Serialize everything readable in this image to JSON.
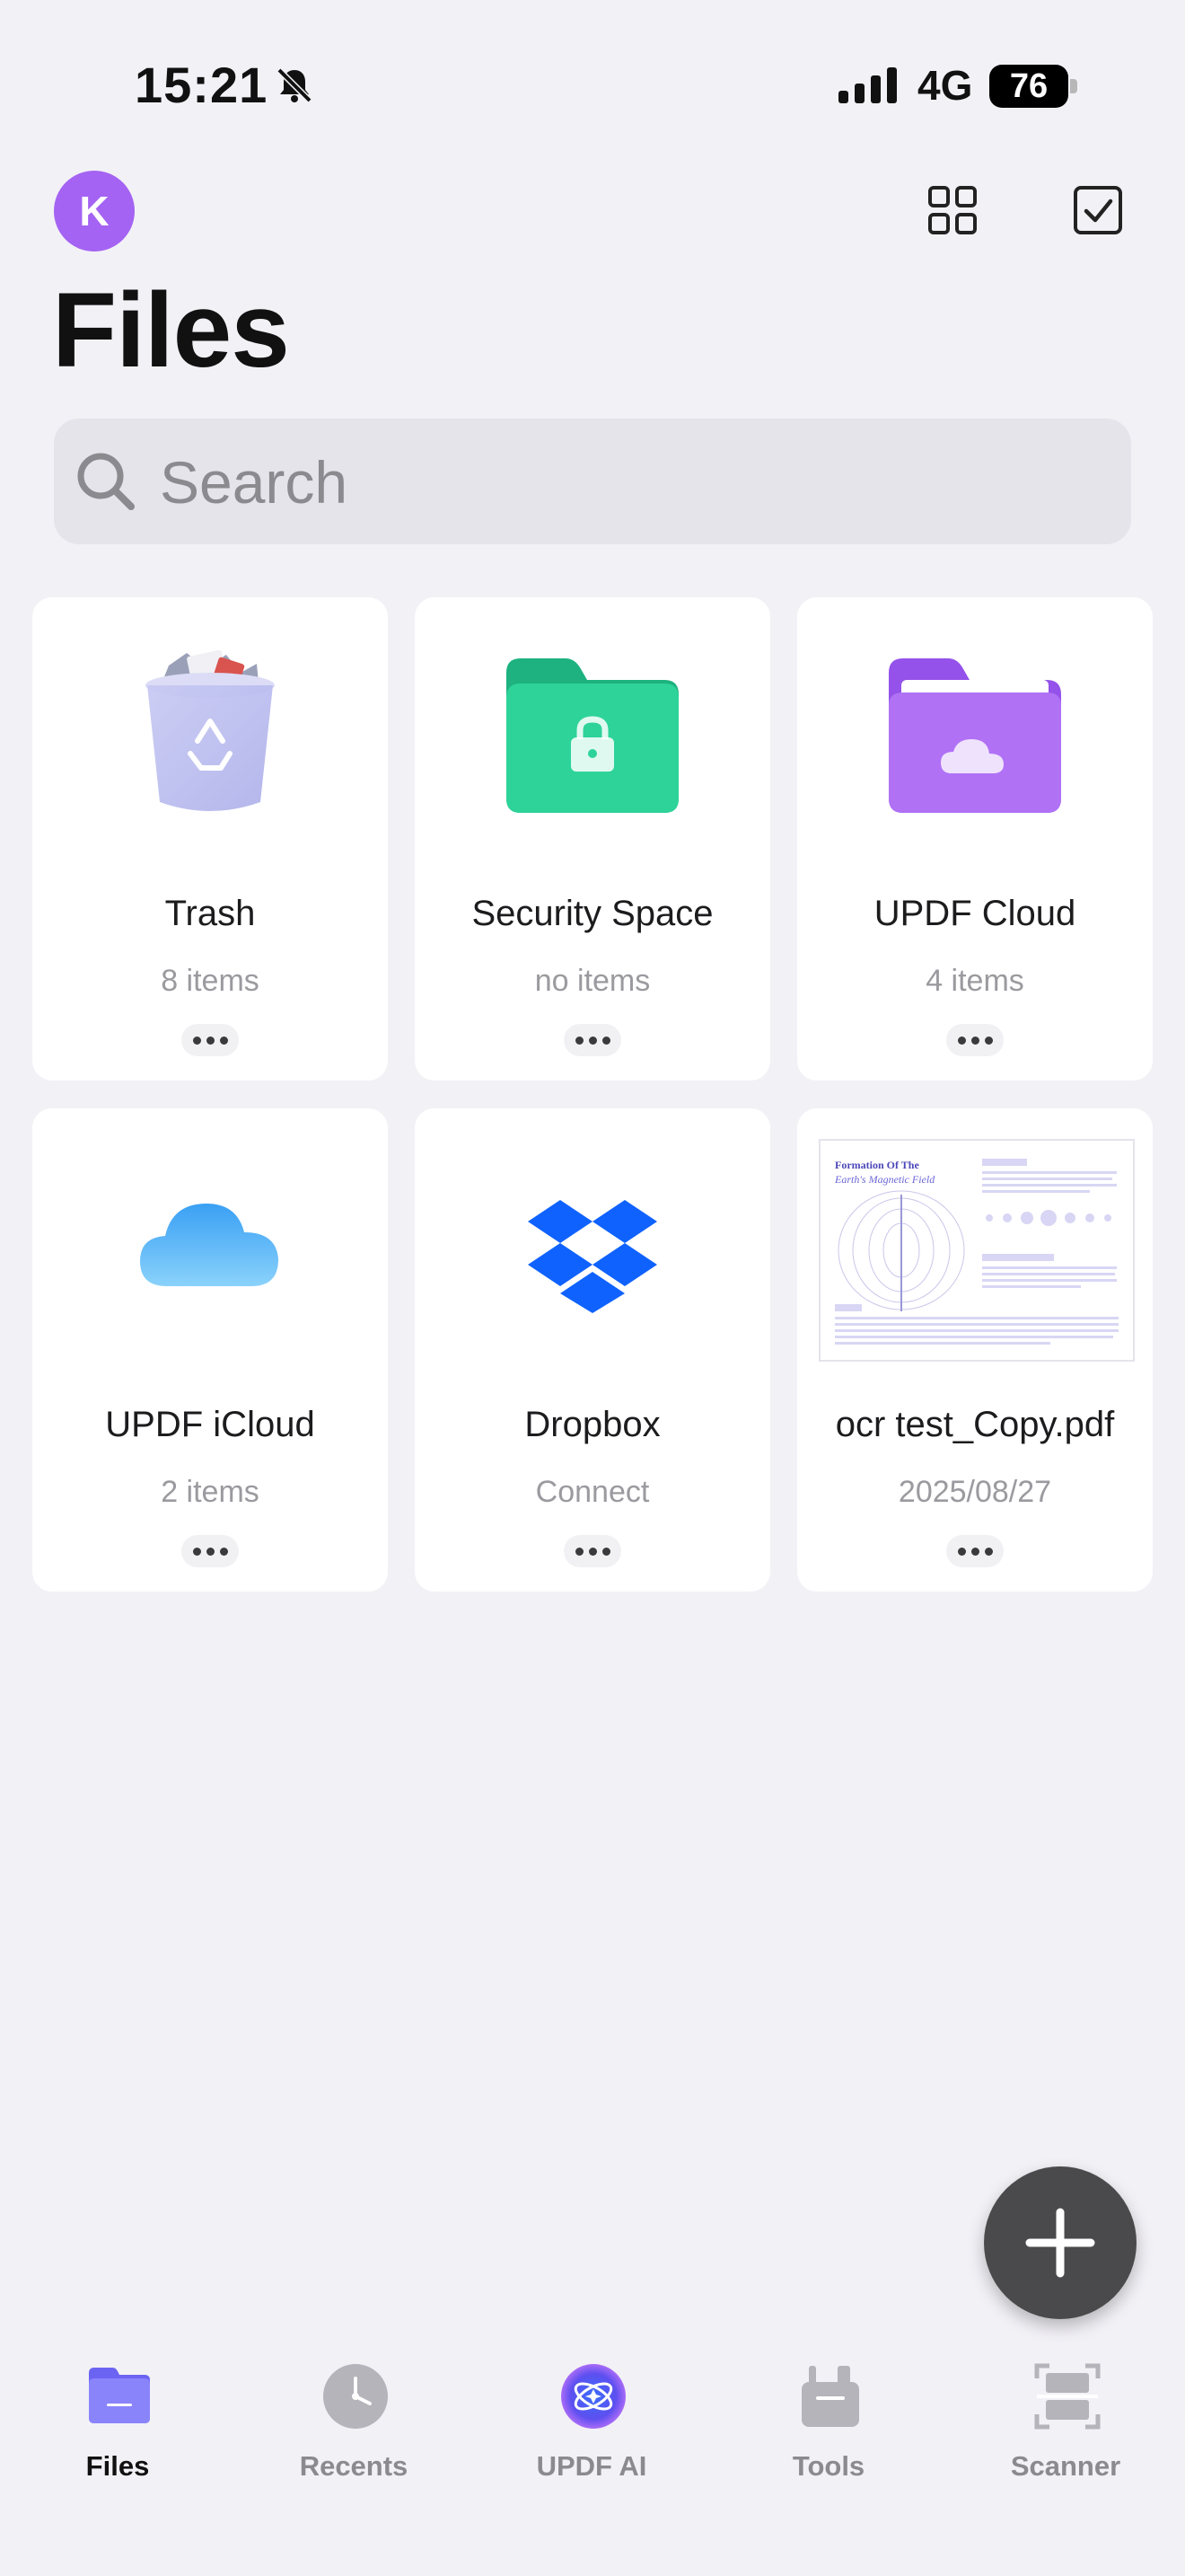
{
  "status_bar": {
    "time": "15:21",
    "network": "4G",
    "battery": "76"
  },
  "header": {
    "avatar_initial": "K",
    "title": "Files"
  },
  "search": {
    "placeholder": "Search"
  },
  "cards": [
    {
      "name": "Trash",
      "sub": "8 items"
    },
    {
      "name": "Security Space",
      "sub": "no items"
    },
    {
      "name": "UPDF Cloud",
      "sub": "4 items"
    },
    {
      "name": "UPDF iCloud",
      "sub": "2 items"
    },
    {
      "name": "Dropbox",
      "sub": "Connect"
    },
    {
      "name": "ocr test_Copy.pdf",
      "sub": "2025/08/27"
    }
  ],
  "pdf_thumb": {
    "title_line1": "Formation Of The",
    "title_line2": "Earth's Magnetic Field"
  },
  "tabs": [
    {
      "label": "Files",
      "icon": "folder-icon",
      "active": true
    },
    {
      "label": "Recents",
      "icon": "clock-icon"
    },
    {
      "label": "UPDF AI",
      "icon": "ai-icon"
    },
    {
      "label": "Tools",
      "icon": "toolbox-icon"
    },
    {
      "label": "Scanner",
      "icon": "scanner-icon"
    }
  ],
  "colors": {
    "accent": "#a463f2",
    "security_green": "#1fbf8a",
    "cloud_purple": "#a55ef0",
    "dropbox_blue": "#0f62fe",
    "tab_active": "#111111",
    "tab_inactive": "#8a8a8f"
  }
}
